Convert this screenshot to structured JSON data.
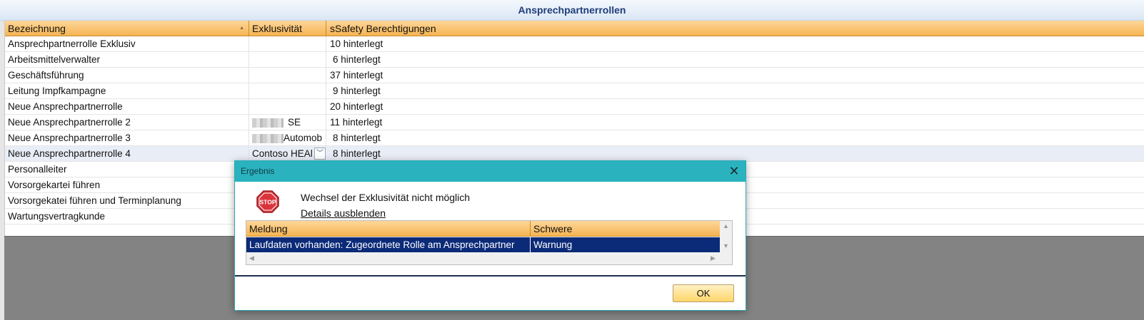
{
  "window": {
    "title": "Ansprechpartnerrollen"
  },
  "grid": {
    "columns": [
      "Bezeichnung",
      "Exklusivität",
      "sSafety Berechtigungen"
    ],
    "rows": [
      {
        "name": "Ansprechpartnerrolle Exklusiv",
        "excl": "",
        "perm": "10 hinterlegt"
      },
      {
        "name": "Arbeitsmittelverwalter",
        "excl": "",
        "perm": "6 hinterlegt"
      },
      {
        "name": "Geschäftsführung",
        "excl": "",
        "perm": "37 hinterlegt"
      },
      {
        "name": "Leitung Impfkampagne",
        "excl": "",
        "perm": "9 hinterlegt"
      },
      {
        "name": "Neue Ansprechpartnerrolle",
        "excl": "",
        "perm": "20 hinterlegt"
      },
      {
        "name": "Neue Ansprechpartnerrolle 2",
        "excl": "SE",
        "perm": "11 hinterlegt"
      },
      {
        "name": "Neue Ansprechpartnerrolle 3",
        "excl": "Automob",
        "perm": "8 hinterlegt"
      },
      {
        "name": "Neue Ansprechpartnerrolle 4",
        "excl": "Contoso HEAl",
        "perm": "8 hinterlegt"
      },
      {
        "name": "Personalleiter",
        "excl": "",
        "perm": ""
      },
      {
        "name": "Vorsorgekartei führen",
        "excl": "",
        "perm": ""
      },
      {
        "name": "Vorsorgekatei führen und Terminplanung",
        "excl": "",
        "perm": ""
      },
      {
        "name": "Wartungsvertragkunde",
        "excl": "",
        "perm": ""
      }
    ],
    "selected_row": "Neue Ansprechpartnerrolle 4"
  },
  "dialog": {
    "title": "Ergebnis",
    "icon": "stop-icon",
    "icon_text": "STOP",
    "message": "Wechsel der Exklusivität nicht möglich",
    "details_link": "Details ausblenden",
    "table": {
      "columns": [
        "Meldung",
        "Schwere"
      ],
      "rows": [
        {
          "meldung": "Laufdaten vorhanden: Zugeordnete Rolle am Ansprechpartner",
          "schwere": "Warnung"
        }
      ]
    },
    "ok_label": "OK"
  },
  "colors": {
    "header_orange": "#f5b452",
    "dialog_teal": "#2ab3bf",
    "selection_navy": "#0b2a78",
    "stop_red": "#d9343b"
  }
}
